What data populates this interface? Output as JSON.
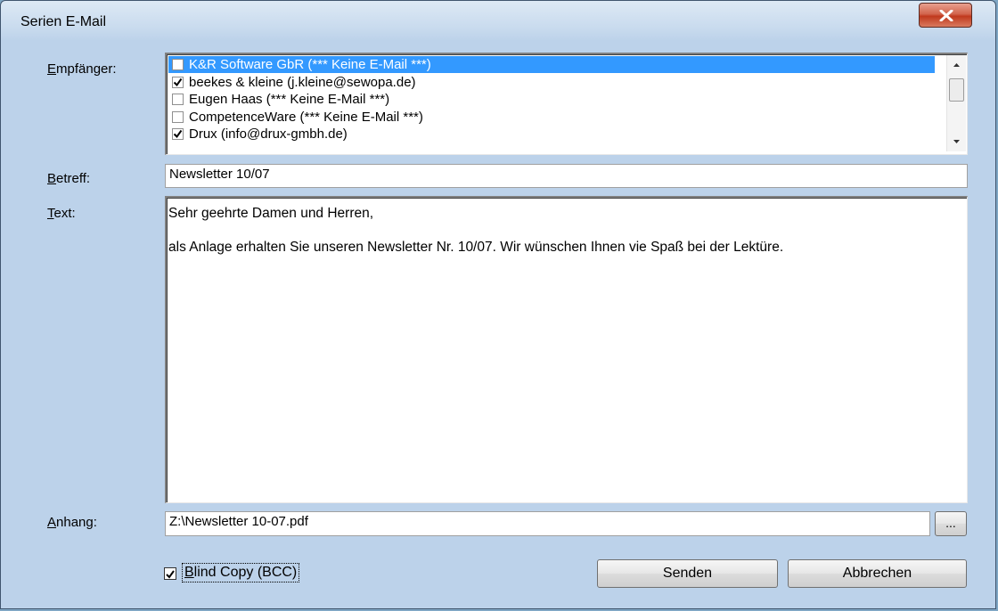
{
  "window": {
    "title": "Serien E-Mail",
    "close_icon": "close-x-icon"
  },
  "labels": {
    "recipients": {
      "mnemonic": "E",
      "rest": "mpfänger:"
    },
    "subject": {
      "mnemonic": "B",
      "rest": "etreff:"
    },
    "text": {
      "mnemonic": "T",
      "rest": "ext:"
    },
    "attachment": {
      "mnemonic": "A",
      "rest": "nhang:"
    }
  },
  "recipients": [
    {
      "text": "K&R Software GbR (*** Keine E-Mail ***)",
      "checked": false,
      "selected": true
    },
    {
      "text": "beekes & kleine (j.kleine@sewopa.de)",
      "checked": true,
      "selected": false
    },
    {
      "text": "Eugen Haas (*** Keine E-Mail ***)",
      "checked": false,
      "selected": false
    },
    {
      "text": "CompetenceWare (*** Keine E-Mail ***)",
      "checked": false,
      "selected": false
    },
    {
      "text": "Drux (info@drux-gmbh.de)",
      "checked": true,
      "selected": false
    }
  ],
  "subject_value": "Newsletter 10/07",
  "body_text": "Sehr geehrte Damen und Herren,\n\nals Anlage erhalten Sie unseren Newsletter Nr. 10/07. Wir wünschen Ihnen vie Spaß bei der Lektüre.",
  "attachment_value": "Z:\\Newsletter 10-07.pdf",
  "browse_label": "...",
  "bcc": {
    "mnemonic": "B",
    "rest": "lind Copy (BCC)",
    "checked": true
  },
  "buttons": {
    "send": "Senden",
    "cancel": "Abbrechen"
  }
}
